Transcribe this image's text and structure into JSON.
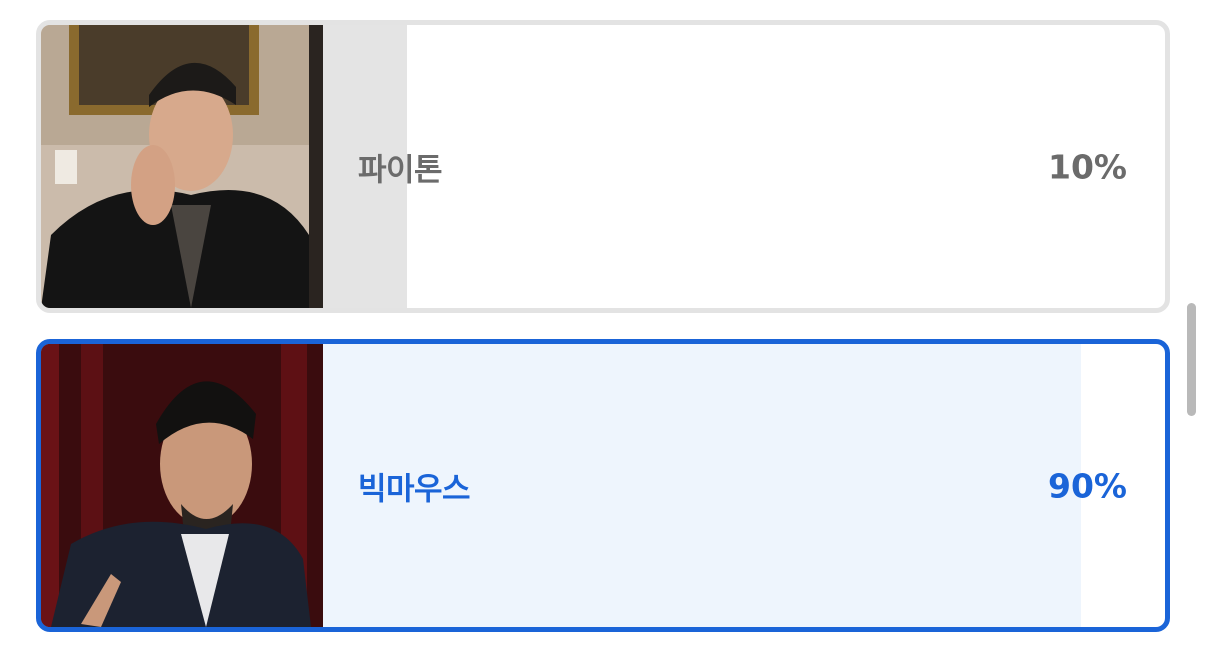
{
  "colors": {
    "accent": "#1a64d8",
    "selected_fill": "#eef5fd",
    "unselected_fill": "#e4e4e4",
    "unselected_text": "#6b6b6b",
    "unselected_border": "#e3e3e3"
  },
  "poll": {
    "options": [
      {
        "label": "파이톤",
        "percent_text": "10%",
        "percent": 10,
        "selected": false
      },
      {
        "label": "빅마우스",
        "percent_text": "90%",
        "percent": 90,
        "selected": true
      }
    ]
  }
}
